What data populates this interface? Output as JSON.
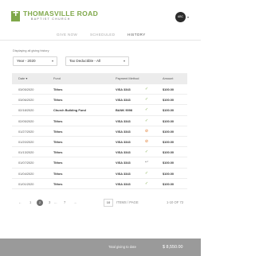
{
  "brand": {
    "title": "THOMASVILLE ROAD",
    "subtitle": "BAPTIST CHURCH",
    "accent": "#7fa84a"
  },
  "user": {
    "initials": "ABC",
    "menu_icon": "chevron-down-icon"
  },
  "tabs": [
    {
      "label": "GIVE NOW",
      "active": false
    },
    {
      "label": "SCHEDULED",
      "active": false
    },
    {
      "label": "HISTORY",
      "active": true
    }
  ],
  "filter_note": "Displaying all giving history",
  "filters": {
    "year": "Year - 2020",
    "tax": "Tax Deductible - All"
  },
  "table": {
    "headers": {
      "date": "Date",
      "date_sort": "▾",
      "fund": "Fund",
      "payment": "Payment Method",
      "amount": "Amount"
    },
    "rows": [
      {
        "date": "03/05/2020",
        "fund": "Tithes",
        "payment": "VISA 3343",
        "status": "✓",
        "amount": "$100.00"
      },
      {
        "date": "03/06/2020",
        "fund": "Tithes",
        "payment": "VISA 3343",
        "status": "✓",
        "amount": "$100.00"
      },
      {
        "date": "02/18/2020",
        "fund": "Church Building Fund",
        "payment": "BANK 9098",
        "status": "✓",
        "amount": "$100.00"
      },
      {
        "date": "02/05/2020",
        "fund": "Tithes",
        "payment": "VISA 3343",
        "status": "✓",
        "amount": "$100.00"
      },
      {
        "date": "01/27/2020",
        "fund": "Tithes",
        "payment": "VISA 3343",
        "status": "⊘",
        "amount": "$100.00"
      },
      {
        "date": "01/20/2020",
        "fund": "Tithes",
        "payment": "VISA 3343",
        "status": "⊘",
        "amount": "$100.00"
      },
      {
        "date": "01/13/2020",
        "fund": "Tithes",
        "payment": "VISA 3343",
        "status": "✓",
        "amount": "$100.00"
      },
      {
        "date": "01/07/2020",
        "fund": "Tithes",
        "payment": "VISA 3343",
        "status": "↩",
        "amount": "$100.00"
      },
      {
        "date": "01/04/2020",
        "fund": "Tithes",
        "payment": "VISA 3343",
        "status": "✓",
        "amount": "$100.00"
      },
      {
        "date": "01/01/2020",
        "fund": "Tithes",
        "payment": "VISA 3343",
        "status": "✓",
        "amount": "$100.00"
      }
    ]
  },
  "pagination": {
    "prev": "←",
    "page1": "1",
    "current": "2",
    "page3": "3",
    "ellipsis": "...",
    "last": "7",
    "next": "→",
    "per_page": "10",
    "per_page_label": "ITEMS / PAGE",
    "range": "1-10 OF 72"
  },
  "footer": {
    "label": "Total giving to date",
    "value": "$ 8,550.00",
    "background": "#9a9a9a"
  }
}
